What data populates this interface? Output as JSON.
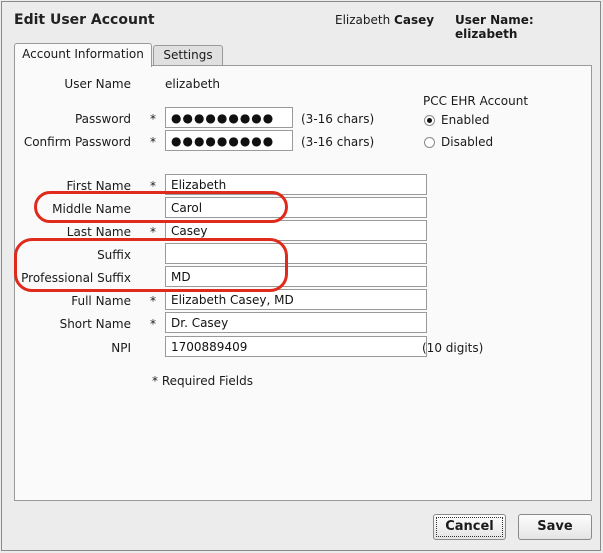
{
  "header": {
    "title": "Edit User Account",
    "first_name": "Elizabeth",
    "last_name": "Casey",
    "username_label": "User Name:",
    "username_value": "elizabeth"
  },
  "tabs": [
    {
      "label": "Account Information",
      "active": true
    },
    {
      "label": "Settings",
      "active": false
    }
  ],
  "form": {
    "username": {
      "label": "User Name",
      "value": "elizabeth"
    },
    "password": {
      "label": "Password",
      "value": "●●●●●●●●●",
      "hint": "(3-16 chars)",
      "required": "*"
    },
    "confirm_password": {
      "label": "Confirm Password",
      "value": "●●●●●●●●●",
      "hint": "(3-16 chars)",
      "required": "*"
    },
    "first_name": {
      "label": "First Name",
      "value": "Elizabeth",
      "required": "*"
    },
    "middle_name": {
      "label": "Middle Name",
      "value": "Carol"
    },
    "last_name": {
      "label": "Last Name",
      "value": "Casey",
      "required": "*"
    },
    "suffix": {
      "label": "Suffix",
      "value": ""
    },
    "professional_suffix": {
      "label": "Professional Suffix",
      "value": "MD"
    },
    "full_name": {
      "label": "Full Name",
      "value": "Elizabeth Casey, MD",
      "required": "*"
    },
    "short_name": {
      "label": "Short Name",
      "value": "Dr. Casey",
      "required": "*"
    },
    "npi": {
      "label": "NPI",
      "value": "1700889409",
      "hint": "(10 digits)"
    },
    "required_note": "* Required Fields"
  },
  "pcc_ehr": {
    "title": "PCC EHR Account",
    "options": [
      {
        "label": "Enabled",
        "selected": true
      },
      {
        "label": "Disabled",
        "selected": false
      }
    ]
  },
  "buttons": {
    "cancel": "Cancel",
    "save": "Save"
  },
  "colors": {
    "highlight": "#e02a1c",
    "background": "#ececec",
    "panel": "#fafafa"
  }
}
